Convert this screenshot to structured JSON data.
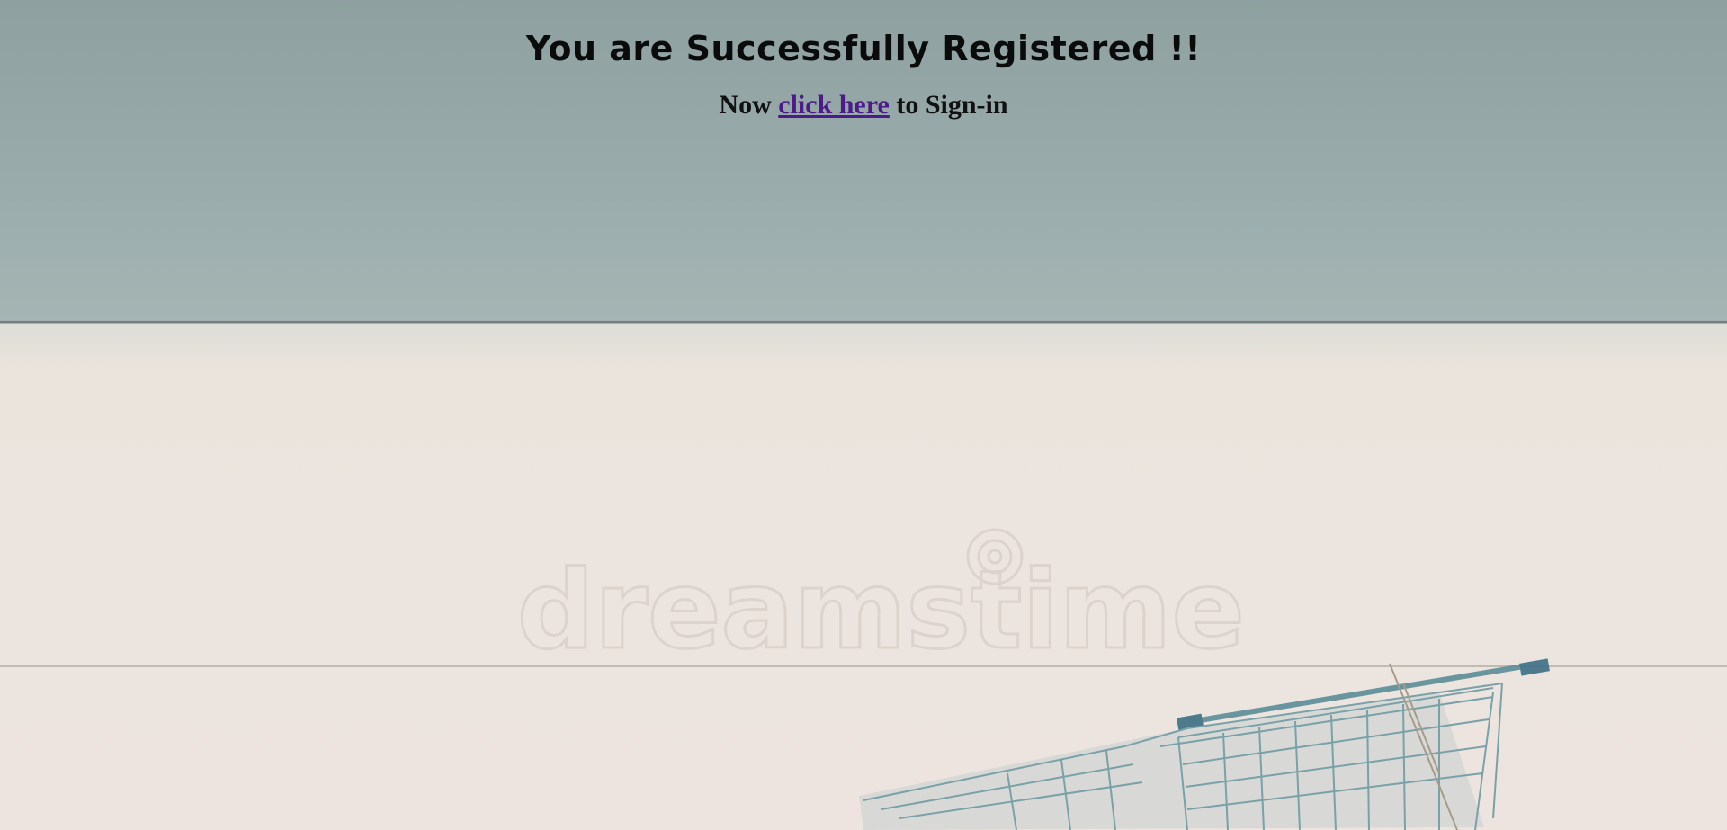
{
  "page": {
    "headline": "You are Successfully Registered !!",
    "signin": {
      "prefix": "Now ",
      "link_label": "click here",
      "suffix": " to Sign-in"
    }
  },
  "background": {
    "watermark": "dreamstime",
    "icon": "shopping-cart-icon",
    "colors": {
      "sky": "#9aacac",
      "wall": "#ede4dd",
      "cart": "#5f8e98",
      "link": "#4b1b8a"
    }
  }
}
